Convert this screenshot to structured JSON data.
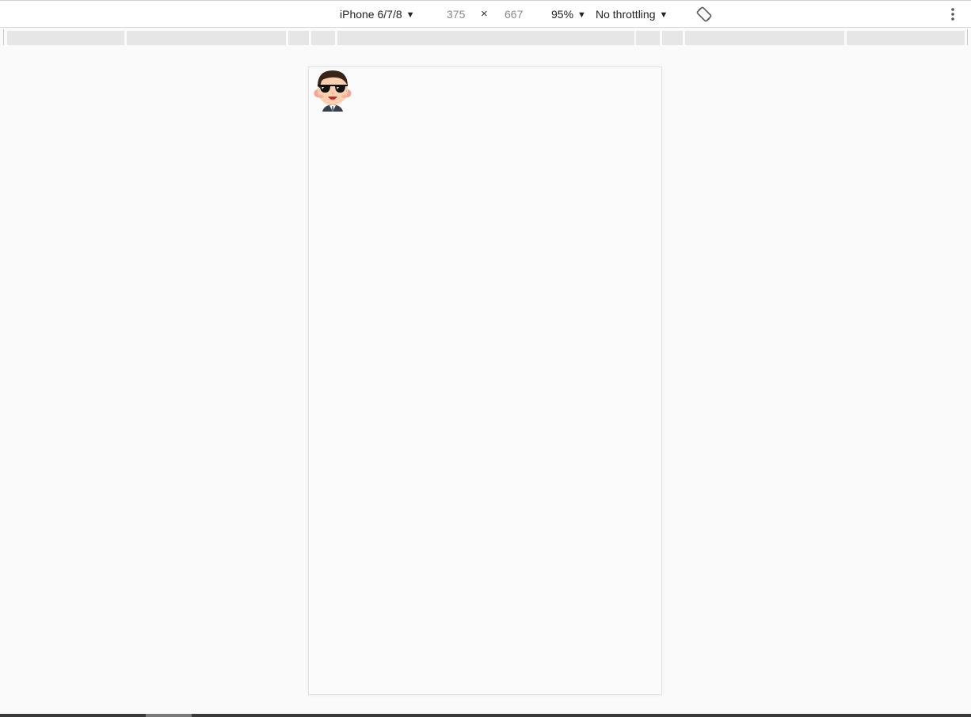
{
  "toolbar": {
    "device_label": "iPhone 6/7/8",
    "width_value": "375",
    "times_symbol": "×",
    "height_value": "667",
    "zoom_label": "95%",
    "throttle_label": "No throttling",
    "caret": "▼",
    "rotate_icon": "rotate-icon",
    "more_icon": "more-vert-icon"
  },
  "viewport": {
    "avatar_icon": "sunglasses-man-avatar"
  },
  "colors": {
    "toolbar_bg": "#ffffff",
    "page_bg": "#fafafa",
    "ruler_segment": "#e6e6e6",
    "viewport_bg": "#fbfbfb"
  }
}
